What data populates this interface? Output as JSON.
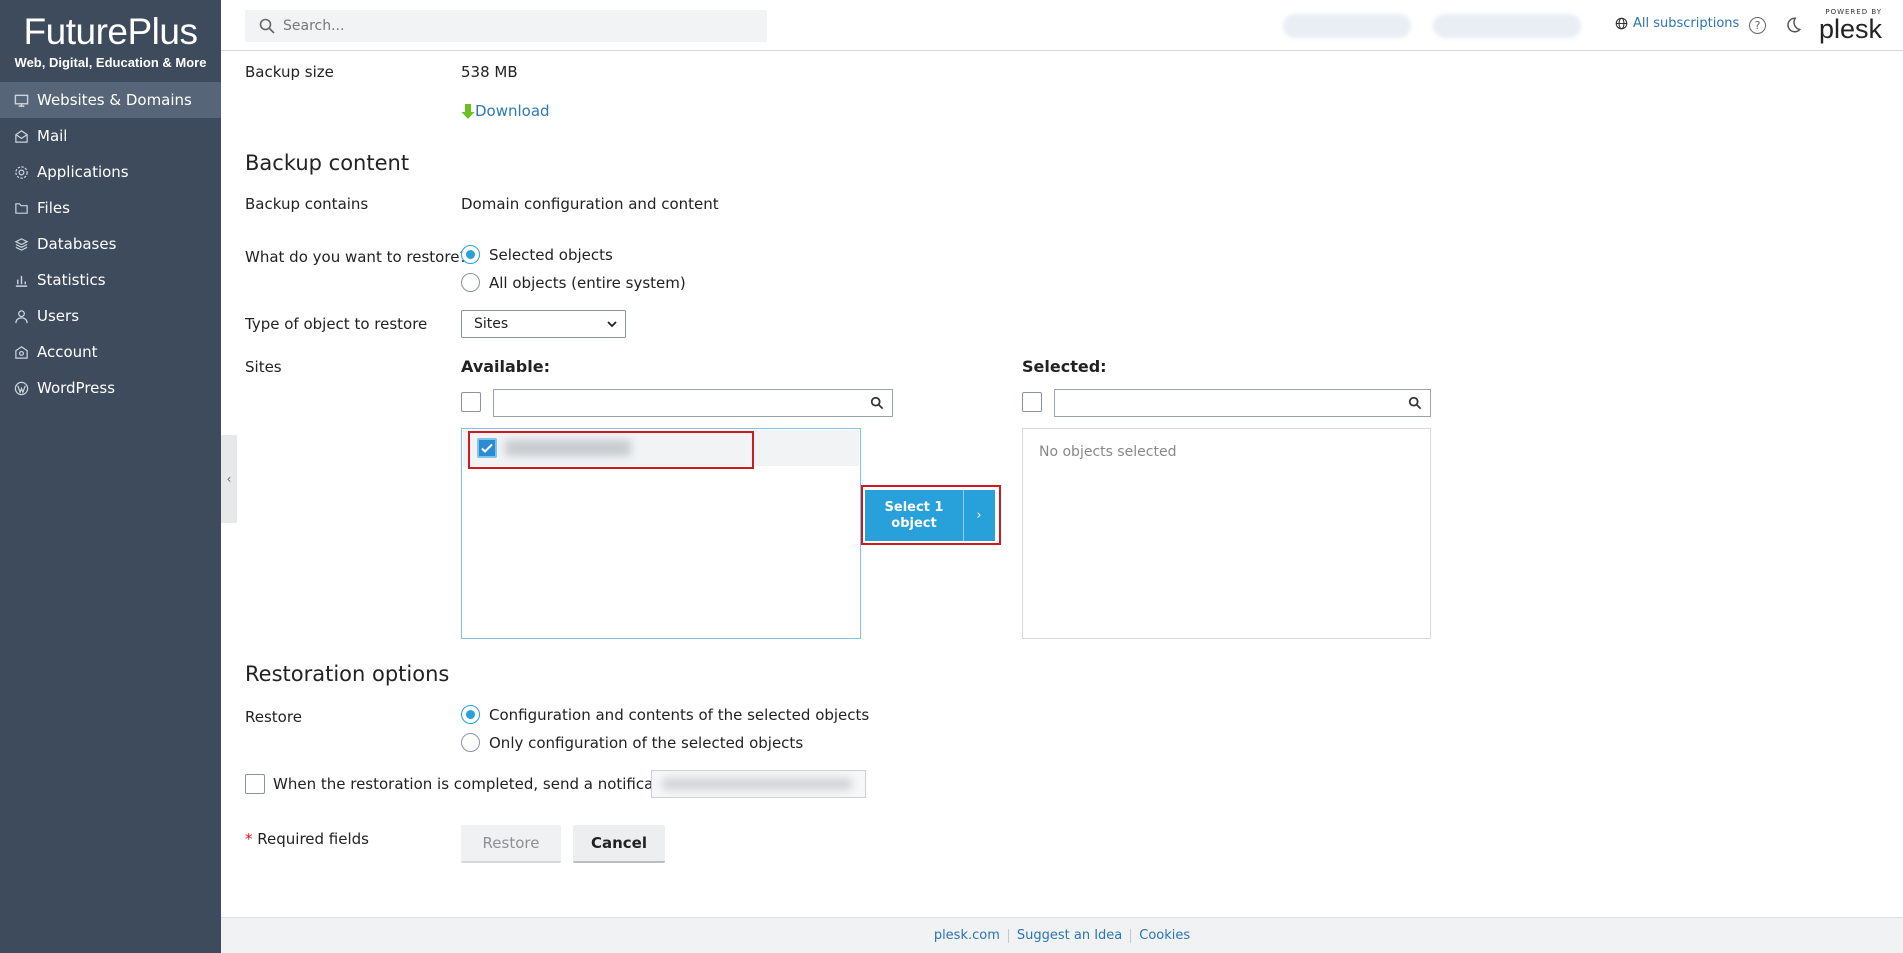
{
  "brand": {
    "name": "FuturePlus",
    "tagline": "Web, Digital, Education & More"
  },
  "sidebar": {
    "items": [
      {
        "label": "Websites & Domains",
        "icon": "monitor-icon",
        "active": true
      },
      {
        "label": "Mail",
        "icon": "mail-icon"
      },
      {
        "label": "Applications",
        "icon": "gear-icon"
      },
      {
        "label": "Files",
        "icon": "folder-icon"
      },
      {
        "label": "Databases",
        "icon": "database-icon"
      },
      {
        "label": "Statistics",
        "icon": "bar-chart-icon"
      },
      {
        "label": "Users",
        "icon": "user-icon"
      },
      {
        "label": "Account",
        "icon": "account-icon"
      },
      {
        "label": "WordPress",
        "icon": "wordpress-icon"
      }
    ]
  },
  "header": {
    "search_placeholder": "Search...",
    "subscriptions_label": "All subscriptions",
    "powered_by": "POWERED BY",
    "plesk": "plesk"
  },
  "backup": {
    "size_label": "Backup size",
    "size_value": "538 MB",
    "download_label": "Download"
  },
  "content_section": {
    "title": "Backup content",
    "contains_label": "Backup contains",
    "contains_value": "Domain configuration and content",
    "restore_question": "What do you want to restore?",
    "restore_options": [
      "Selected objects",
      "All objects (entire system)"
    ],
    "restore_selected": 0,
    "type_label": "Type of object to restore",
    "type_value": "Sites",
    "sites_label": "Sites",
    "available_label": "Available:",
    "selected_label": "Selected:",
    "select_button": "Select 1 object",
    "no_objects": "No objects selected"
  },
  "restoration": {
    "title": "Restoration options",
    "restore_label": "Restore",
    "options": [
      "Configuration and contents of the selected objects",
      "Only configuration of the selected objects"
    ],
    "selected": 0,
    "notify_label": "When the restoration is completed, send a notification to",
    "required_text": "Required fields",
    "required_star": "*",
    "restore_button": "Restore",
    "cancel_button": "Cancel"
  },
  "footer": {
    "links": [
      "plesk.com",
      "Suggest an Idea",
      "Cookies"
    ]
  },
  "colors": {
    "sidebar": "#3d4b5d",
    "accent": "#28a0d9",
    "highlight": "#d0181f",
    "link": "#2a7ab8"
  }
}
